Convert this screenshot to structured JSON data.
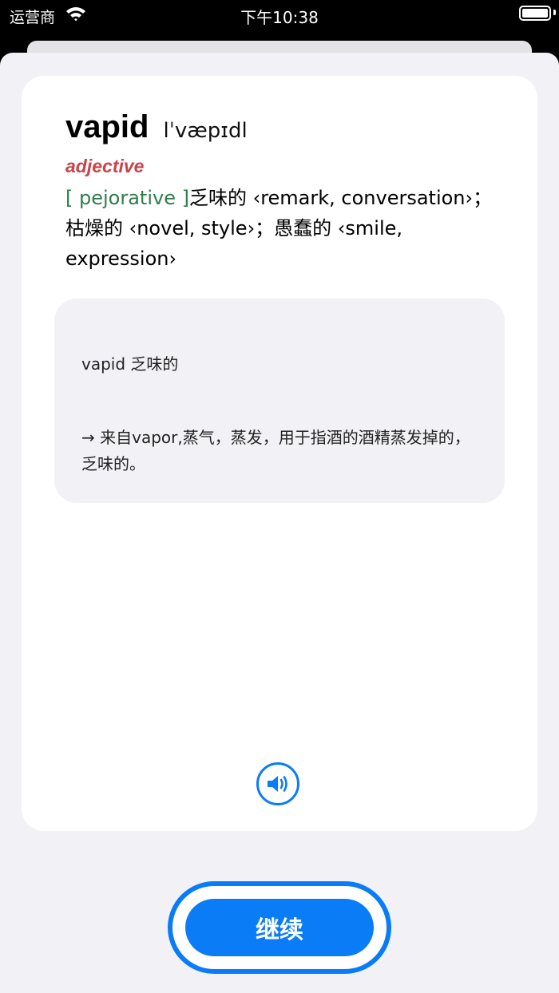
{
  "status_bar": {
    "carrier": "运营商",
    "time": "下午10:38"
  },
  "entry": {
    "word": "vapid",
    "phonetic": "lˈvæpɪdl",
    "part_of_speech": "adjective",
    "usage_tag": "[ pejorative ]",
    "definition": "乏味的 ‹remark, conversation›；枯燥的 ‹novel, style›；愚蠢的 ‹smile, expression›"
  },
  "etymology": {
    "title": "vapid 乏味的",
    "body": "→ 来自vapor,蒸气，蒸发，用于指酒的酒精蒸发掉的，乏味的。"
  },
  "actions": {
    "continue_label": "继续"
  },
  "icons": {
    "speaker": "speaker-icon",
    "wifi": "wifi-icon",
    "battery": "battery-icon"
  },
  "colors": {
    "accent": "#0a7cf6",
    "part_of_speech": "#c8434a",
    "usage_tag": "#2e7d4a"
  }
}
